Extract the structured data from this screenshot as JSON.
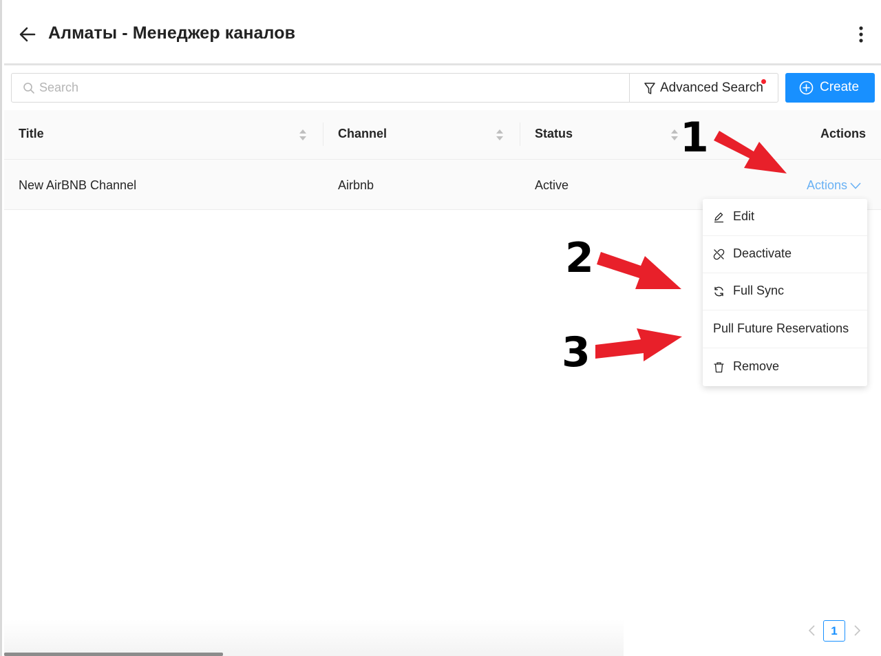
{
  "header": {
    "title": "Алматы - Менеджер каналов",
    "back_icon": "arrow-left-icon",
    "more_icon": "more-vertical-icon"
  },
  "toolbar": {
    "search_placeholder": "Search",
    "search_value": "",
    "advanced_search_label": "Advanced Search",
    "create_label": "Create"
  },
  "table": {
    "columns": [
      "Title",
      "Channel",
      "Status",
      "Actions"
    ],
    "rows": [
      {
        "title": "New AirBNB Channel",
        "channel": "Airbnb",
        "status": "Active",
        "actions_label": "Actions"
      }
    ]
  },
  "actions_menu": {
    "items": [
      {
        "label": "Edit",
        "icon": "edit-icon"
      },
      {
        "label": "Deactivate",
        "icon": "unlink-icon"
      },
      {
        "label": "Full Sync",
        "icon": "sync-icon"
      },
      {
        "label": "Pull Future Reservations",
        "icon": ""
      },
      {
        "label": "Remove",
        "icon": "trash-icon"
      }
    ]
  },
  "annotations": {
    "n1": "1",
    "n2": "2",
    "n3": "3",
    "arrow_color": "#e8202a"
  },
  "pagination": {
    "current_page": "1"
  },
  "colors": {
    "primary": "#1890ff",
    "link": "#69b1f4",
    "badge_dot": "#f5222d"
  }
}
